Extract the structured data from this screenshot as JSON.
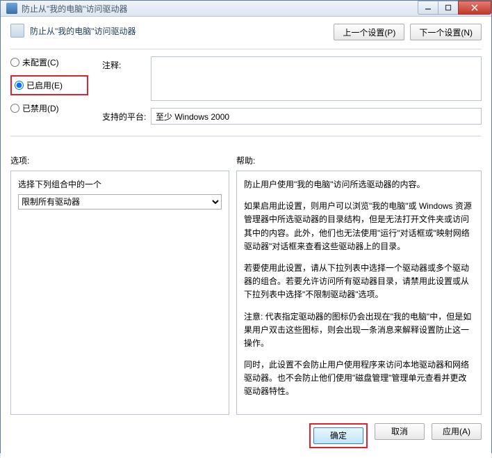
{
  "window": {
    "title": "防止从\"我的电脑\"访问驱动器"
  },
  "header": {
    "title": "防止从\"我的电脑\"访问驱动器",
    "prev": "上一个设置(P)",
    "next": "下一个设置(N)"
  },
  "radios": {
    "not_configured": "未配置(C)",
    "enabled": "已启用(E)",
    "disabled": "已禁用(D)"
  },
  "fields": {
    "comment_label": "注释:",
    "comment_value": "",
    "platform_label": "支持的平台:",
    "platform_value": "至少 Windows 2000"
  },
  "sections": {
    "options": "选项:",
    "help": "帮助:"
  },
  "options": {
    "combo_label": "选择下列组合中的一个",
    "combo_value": "限制所有驱动器"
  },
  "help": {
    "p1": "防止用户使用\"我的电脑\"访问所选驱动器的内容。",
    "p2": "如果启用此设置，则用户可以浏览\"我的电脑\"或 Windows 资源管理器中所选驱动器的目录结构，但是无法打开文件夹或访问其中的内容。此外，他们也无法使用\"运行\"对话框或\"映射网络驱动器\"对话框来查看这些驱动器上的目录。",
    "p3": "若要使用此设置，请从下拉列表中选择一个驱动器或多个驱动器的组合。若要允许访问所有驱动器目录，请禁用此设置或从下拉列表中选择\"不限制驱动器\"选项。",
    "p4": "注意: 代表指定驱动器的图标仍会出现在\"我的电脑\"中，但是如果用户双击这些图标，则会出现一条消息来解释设置防止这一操作。",
    "p5": "同时，此设置不会防止用户使用程序来访问本地驱动器和网络驱动器。也不会防止他们使用\"磁盘管理\"管理单元查看并更改驱动器特性。"
  },
  "footer": {
    "ok": "确定",
    "cancel": "取消",
    "apply": "应用(A)"
  }
}
